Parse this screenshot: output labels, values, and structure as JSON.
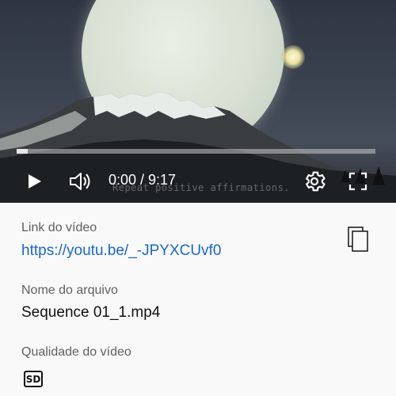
{
  "player": {
    "time_display": "0:00 / 9:17",
    "overlay_caption": "Repeat positive affirmations.",
    "progress": 0.0,
    "buffered": 0.03
  },
  "info": {
    "link_label": "Link do vídeo",
    "link_url": "https://youtu.be/_-JPYXCUvf0",
    "filename_label": "Nome do arquivo",
    "filename_value": "Sequence 01_1.mp4",
    "quality_label": "Qualidade do vídeo",
    "quality_badge": "SD"
  },
  "icons": {
    "play": "play-icon",
    "volume": "volume-icon",
    "settings": "gear-icon",
    "fullscreen": "fullscreen-icon",
    "copy": "copy-icon"
  },
  "colors": {
    "link": "#1a66cc",
    "label": "#606060",
    "background": "#f9f9f9"
  }
}
